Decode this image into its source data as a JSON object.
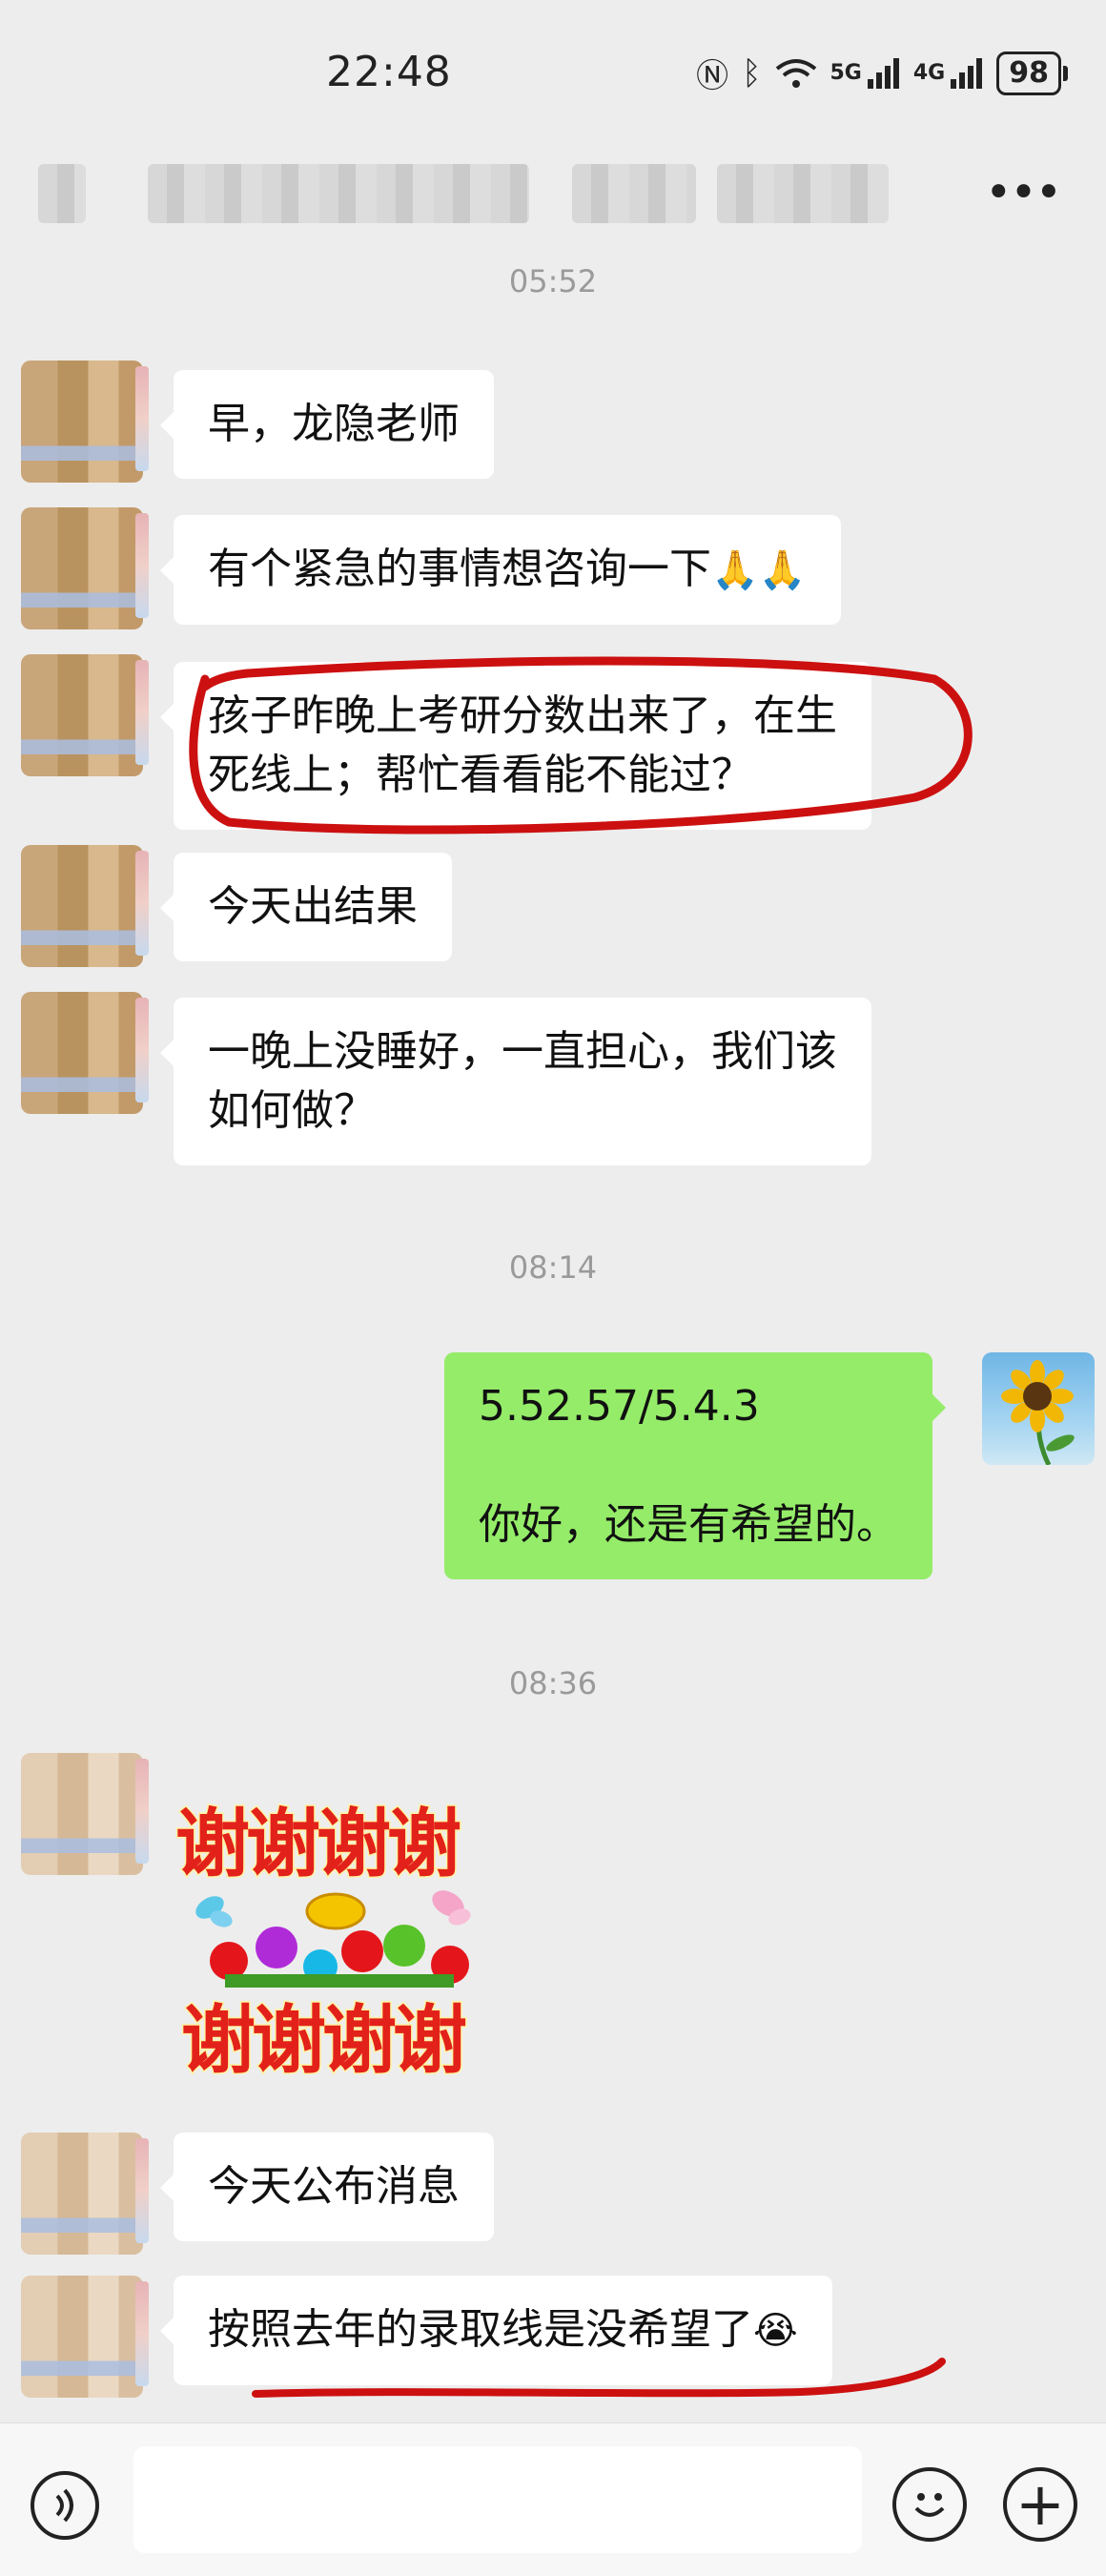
{
  "status_bar": {
    "time": "22:48",
    "network_1": "5G",
    "network_2": "4G",
    "battery": "98"
  },
  "header": {
    "more_label": "•••"
  },
  "timestamps": [
    "05:52",
    "08:14",
    "08:36"
  ],
  "messages": [
    {
      "from": "other",
      "lines": [
        "早，龙隐老师"
      ]
    },
    {
      "from": "other",
      "lines": [
        "有个紧急的事情想咨询一下"
      ],
      "emoji": "🙏🙏"
    },
    {
      "from": "other",
      "lines": [
        "孩子昨晚上考研分数出来了，在生",
        "死线上；帮忙看看能不能过？"
      ]
    },
    {
      "from": "other",
      "lines": [
        "今天出结果"
      ]
    },
    {
      "from": "other",
      "lines": [
        "一晚上没睡好，一直担心，我们该",
        "如何做？"
      ]
    },
    {
      "from": "me",
      "lines": [
        "5.52.57/5.4.3",
        "",
        "你好，还是有希望的。"
      ]
    },
    {
      "from": "other",
      "type": "sticker",
      "sticker_text": [
        "谢谢谢谢",
        "谢谢谢谢"
      ]
    },
    {
      "from": "other",
      "lines": [
        "今天公布消息"
      ]
    },
    {
      "from": "other",
      "lines": [
        "按照去年的录取线是没希望了"
      ],
      "emoji": "😭"
    }
  ],
  "input_bar": {
    "placeholder": "",
    "plus_label": "+"
  },
  "colors": {
    "background": "#ededed",
    "my_bubble": "#95ec69",
    "annotation_red": "#cc1010"
  }
}
